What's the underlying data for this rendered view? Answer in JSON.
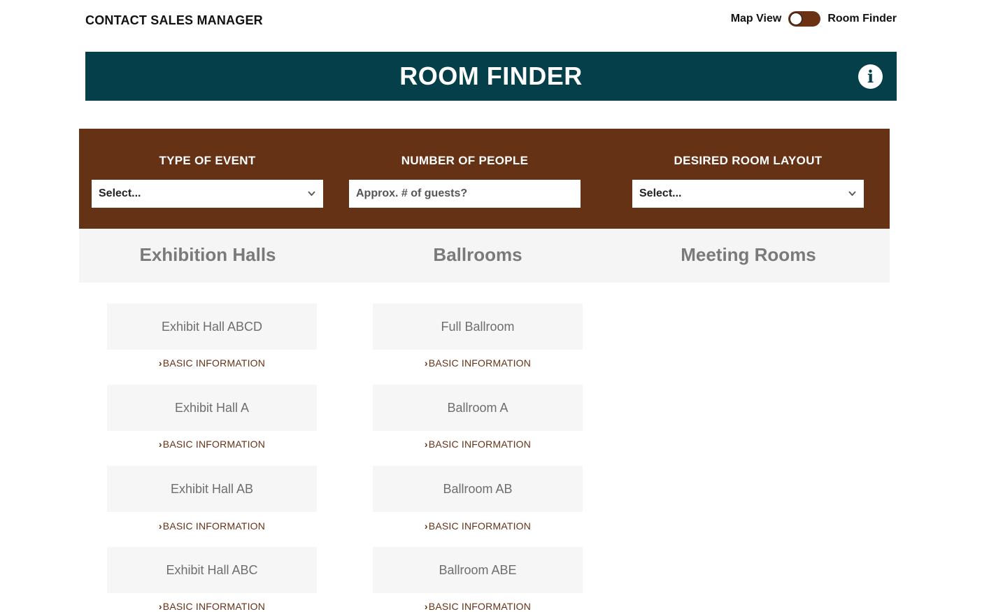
{
  "header": {
    "contact_label": "CONTACT SALES MANAGER",
    "map_view_label": "Map View",
    "room_finder_label": "Room Finder"
  },
  "banner": {
    "title": "ROOM FINDER",
    "info_glyph": "i"
  },
  "filters": [
    {
      "label": "TYPE OF EVENT",
      "value": "Select..."
    },
    {
      "label": "NUMBER OF PEOPLE",
      "placeholder": "Approx. # of guests?"
    },
    {
      "label": "DESIRED ROOM LAYOUT",
      "value": "Select..."
    }
  ],
  "categories": [
    "Exhibition Halls",
    "Ballrooms",
    "Meeting Rooms"
  ],
  "rooms": {
    "exhibition_halls": [
      "Exhibit Hall ABCD",
      "Exhibit Hall A",
      "Exhibit Hall AB",
      "Exhibit Hall ABC"
    ],
    "ballrooms": [
      "Full Ballroom",
      "Ballroom A",
      "Ballroom AB",
      "Ballroom ABE"
    ]
  },
  "info_link_label": "BASIC INFORMATION",
  "info_arrow": "›",
  "colors": {
    "banner": "#043f4a",
    "filters": "#663216",
    "link": "#663216"
  }
}
